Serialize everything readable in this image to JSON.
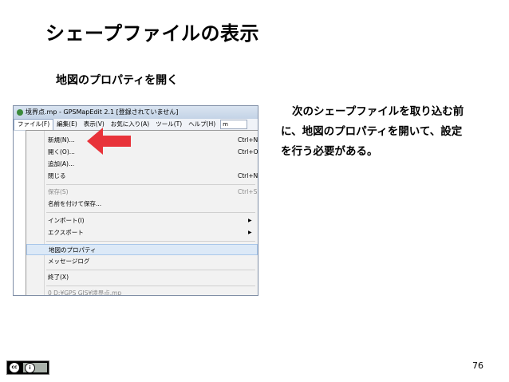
{
  "slide": {
    "title": "シェープファイルの表示",
    "subtitle": "地図のプロパティを開く",
    "description_lines": [
      "次のシェープファイルを取り込む前",
      "に、地図のプロパティを開いて、設定",
      "を行う必要がある。"
    ],
    "page_number": "76"
  },
  "screenshot": {
    "window_title": "境界点.mp - GPSMapEdit 2.1 [登録されていません]",
    "menubar": {
      "items": [
        "ファイル(F)",
        "編集(E)",
        "表示(V)",
        "お気に入り(A)",
        "ツール(T)",
        "ヘルプ(H)"
      ],
      "toolbox_value": "m"
    },
    "file_menu": {
      "items": [
        {
          "label": "新規(N)...",
          "shortcut": "Ctrl+N"
        },
        {
          "label": "開く(O)...",
          "shortcut": "Ctrl+O"
        },
        {
          "label": "追加(A)...",
          "shortcut": ""
        },
        {
          "label": "閉じる",
          "shortcut": "Ctrl+N"
        },
        {
          "label": "保存(S)",
          "shortcut": "Ctrl+S"
        },
        {
          "label": "名前を付けて保存...",
          "shortcut": ""
        },
        {
          "label": "インポート(I)",
          "shortcut": ""
        },
        {
          "label": "エクスポート",
          "shortcut": ""
        },
        {
          "label": "地図のプロパティ",
          "shortcut": ""
        },
        {
          "label": "メッセージログ",
          "shortcut": ""
        },
        {
          "label": "終了(X)",
          "shortcut": ""
        },
        {
          "label": "0 D:¥GPS GIS¥境界点.mp",
          "shortcut": ""
        }
      ]
    },
    "arrow_color": "#e8333a",
    "highlight_color": "#dce9f7"
  },
  "license": {
    "icon": "cc-by-icon"
  }
}
